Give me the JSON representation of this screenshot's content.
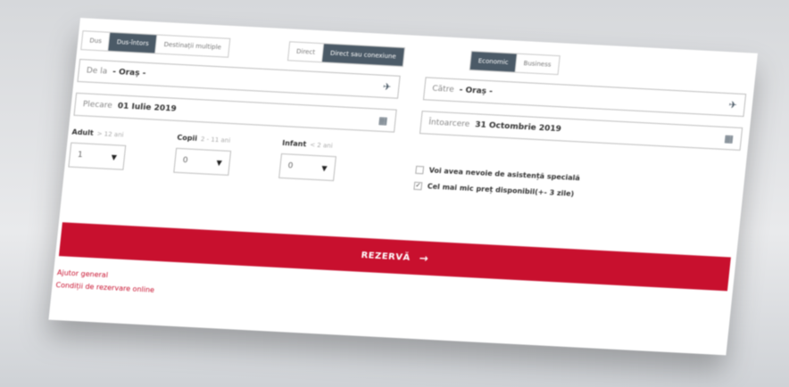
{
  "trip_type": [
    "Dus",
    "Dus-întors",
    "Destinații multiple"
  ],
  "trip_type_active": 1,
  "route_type": [
    "Direct",
    "Direct sau conexiune"
  ],
  "route_type_active": 1,
  "cabin": [
    "Economic",
    "Business"
  ],
  "cabin_active": 0,
  "from": {
    "label": "De la",
    "value": "- Oraș -"
  },
  "to": {
    "label": "Către",
    "value": "- Oraș -"
  },
  "depart": {
    "label": "Plecare",
    "value": "01 Iulie 2019"
  },
  "return": {
    "label": "Întoarcere",
    "value": "31 Octombrie 2019"
  },
  "passengers": {
    "adult": {
      "label": "Adult",
      "hint": "> 12 ani",
      "value": "1"
    },
    "child": {
      "label": "Copii",
      "hint": "2 - 11 ani",
      "value": "0"
    },
    "infant": {
      "label": "Infant",
      "hint": "< 2 ani",
      "value": "0"
    }
  },
  "options": {
    "assistance": "Voi avea nevoie de asistență specială",
    "lowest_price": "Cel mai mic preț disponibil(+- 3 zile)"
  },
  "submit_label": "REZERVĂ",
  "links": {
    "help": "Ajutor general",
    "terms": "Condiții de rezervare online"
  },
  "colors": {
    "accent": "#c8102e",
    "toggle_active": "#4b5a67"
  }
}
